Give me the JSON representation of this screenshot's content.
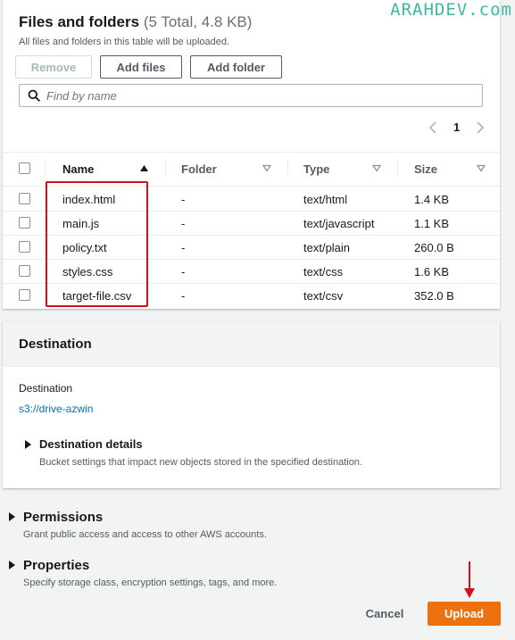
{
  "watermark": "ARAHDEV.com",
  "files": {
    "title": "Files and folders",
    "summary": "(5 Total, 4.8 KB)",
    "description": "All files and folders in this table will be uploaded.",
    "buttons": {
      "remove": "Remove",
      "add_files": "Add files",
      "add_folder": "Add folder"
    },
    "search": {
      "placeholder": "Find by name",
      "value": ""
    },
    "pagination": {
      "page": "1"
    },
    "columns": {
      "name": "Name",
      "folder": "Folder",
      "type": "Type",
      "size": "Size"
    },
    "rows": [
      {
        "name": "index.html",
        "folder": "-",
        "type": "text/html",
        "size": "1.4 KB"
      },
      {
        "name": "main.js",
        "folder": "-",
        "type": "text/javascript",
        "size": "1.1 KB"
      },
      {
        "name": "policy.txt",
        "folder": "-",
        "type": "text/plain",
        "size": "260.0 B"
      },
      {
        "name": "styles.css",
        "folder": "-",
        "type": "text/css",
        "size": "1.6 KB"
      },
      {
        "name": "target-file.csv",
        "folder": "-",
        "type": "text/csv",
        "size": "352.0 B"
      }
    ]
  },
  "destination": {
    "header": "Destination",
    "label": "Destination",
    "link": "s3://drive-azwin",
    "details_title": "Destination details",
    "details_desc": "Bucket settings that impact new objects stored in the specified destination."
  },
  "permissions": {
    "title": "Permissions",
    "desc": "Grant public access and access to other AWS accounts."
  },
  "properties": {
    "title": "Properties",
    "desc": "Specify storage class, encryption settings, tags, and more."
  },
  "actions": {
    "cancel": "Cancel",
    "upload": "Upload"
  },
  "colors": {
    "accent": "#ec7211",
    "link": "#0073bb",
    "annotation": "#d0101a"
  }
}
